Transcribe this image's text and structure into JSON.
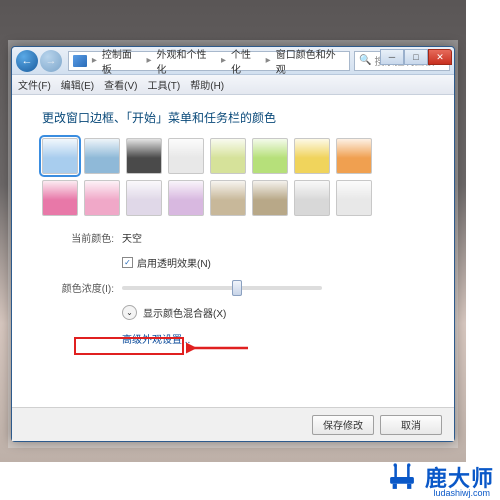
{
  "breadcrumb": {
    "root": "控制面板",
    "mid": "外观和个性化",
    "sub": "个性化",
    "leaf": "窗口颜色和外观"
  },
  "search": {
    "placeholder": "搜索控制面板"
  },
  "menubar": {
    "file": "文件(F)",
    "edit": "编辑(E)",
    "view": "查看(V)",
    "tools": "工具(T)",
    "help": "帮助(H)"
  },
  "heading": "更改窗口边框、「开始」菜单和任务栏的颜色",
  "colors": [
    "#a8cdee",
    "#8fb9d8",
    "#4a4a4a",
    "#e8e8e8",
    "#d6e29a",
    "#b6e07a",
    "#f0d45c",
    "#f0a050",
    "#e878a8",
    "#f0a8c8",
    "#e0d8e8",
    "#d8b8e0",
    "#c8b89a",
    "#b8a888",
    "#d8d8d8",
    "#e8e8e8"
  ],
  "selected_color": 0,
  "current": {
    "label": "当前颜色:",
    "value": "天空"
  },
  "transparency": {
    "label": "启用透明效果(N)",
    "checked": true
  },
  "intensity": {
    "label": "颜色浓度(I):",
    "value": 0.58
  },
  "mixer": {
    "label": "显示颜色混合器(X)"
  },
  "advanced": {
    "label": "高级外观设置..."
  },
  "footer": {
    "save": "保存修改",
    "cancel": "取消"
  },
  "watermark": {
    "name": "鹿大师",
    "url": "ludashiwj.com"
  }
}
